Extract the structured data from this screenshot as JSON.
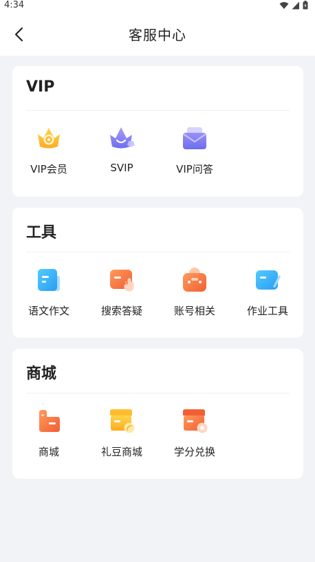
{
  "status_bar": {
    "time": "4:34"
  },
  "header": {
    "title": "客服中心"
  },
  "sections": [
    {
      "title": "VIP",
      "items": [
        {
          "label": "VIP会员",
          "icon": "crown-icon"
        },
        {
          "label": "SVIP",
          "icon": "svip-crown-icon"
        },
        {
          "label": "VIP问答",
          "icon": "mail-icon"
        }
      ]
    },
    {
      "title": "工具",
      "items": [
        {
          "label": "语文作文",
          "icon": "notebook-icon"
        },
        {
          "label": "搜索答疑",
          "icon": "search-question-icon"
        },
        {
          "label": "账号相关",
          "icon": "account-icon"
        },
        {
          "label": "作业工具",
          "icon": "homework-tool-icon"
        }
      ]
    },
    {
      "title": "商城",
      "items": [
        {
          "label": "商城",
          "icon": "store-icon"
        },
        {
          "label": "礼豆商城",
          "icon": "bean-store-icon"
        },
        {
          "label": "学分兑换",
          "icon": "credit-exchange-icon"
        }
      ]
    }
  ],
  "colors": {
    "background": "#f2f3f7",
    "vip_gold": "#ffc53d",
    "svip_purple": "#8c84f4",
    "tool_blue": "#3ab4f7",
    "tool_orange": "#ff7a45"
  }
}
